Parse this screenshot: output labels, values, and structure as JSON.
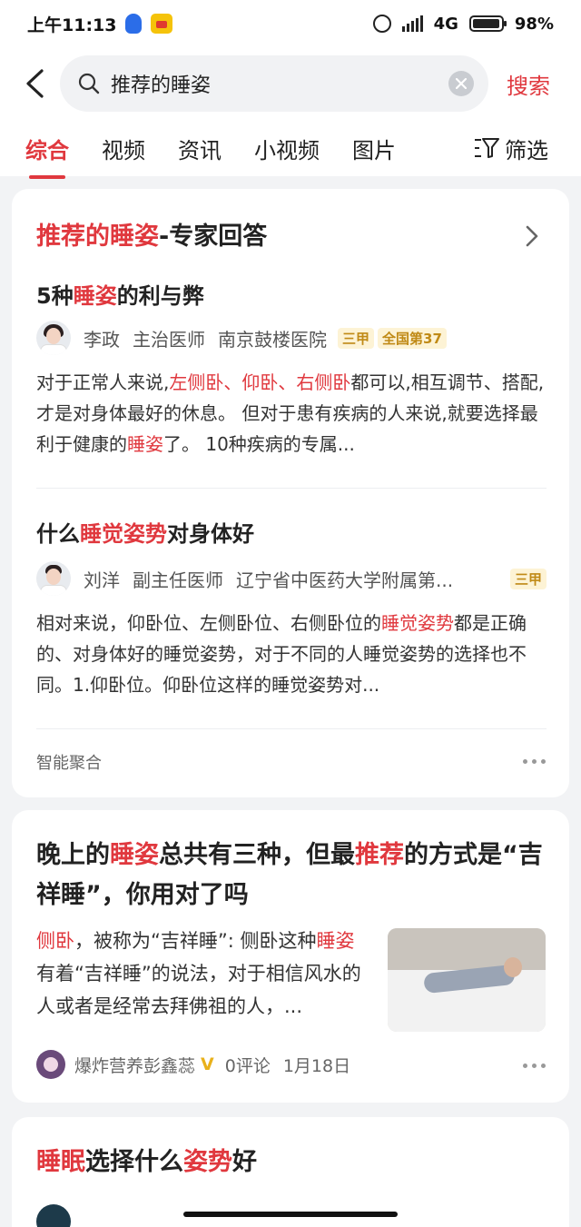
{
  "status_bar": {
    "time": "上午11:13",
    "network": "4G",
    "battery": "98%",
    "battery_level": 0.98,
    "icons": [
      "qq-icon",
      "app-badge-icon",
      "alarm-icon",
      "signal-icon",
      "battery-icon"
    ]
  },
  "search": {
    "query": "推荐的睡姿",
    "submit_label": "搜索"
  },
  "tabs": [
    {
      "label": "综合",
      "active": true
    },
    {
      "label": "视频",
      "active": false
    },
    {
      "label": "资讯",
      "active": false
    },
    {
      "label": "小视频",
      "active": false
    },
    {
      "label": "图片",
      "active": false
    }
  ],
  "filter_label": "筛选",
  "expert_card": {
    "head_highlight": "推荐的睡姿",
    "head_rest": "-专家回答",
    "answers": [
      {
        "title_pre": "5种",
        "title_hl": "睡姿",
        "title_post": "的利与弊",
        "doctor": "李政",
        "rank": "主治医师",
        "hospital": "南京鼓楼医院",
        "tags": [
          "三甲",
          "全国第37"
        ],
        "snippet_1": "对于正常人来说,",
        "snippet_hl1": "左侧卧、仰卧、右侧卧",
        "snippet_2": "都可以,相互调节、搭配,才是对身体最好的休息。 但对于患有疾病的人来说,就要选择最利于健康的",
        "snippet_hl2": "睡姿",
        "snippet_3": "了。 10种疾病的专属..."
      },
      {
        "title_pre": "什么",
        "title_hl": "睡觉姿势",
        "title_post": "对身体好",
        "doctor": "刘洋",
        "rank": "副主任医师",
        "hospital": "辽宁省中医药大学附属第...",
        "tags": [
          "三甲"
        ],
        "snippet_1": "相对来说，仰卧位、左侧卧位、右侧卧位的",
        "snippet_hl1": "睡觉姿势",
        "snippet_2": "都是正确的、对身体好的睡觉姿势，对于不同的人睡觉姿势的选择也不同。1.仰卧位。仰卧位这样的睡觉姿势对..."
      }
    ],
    "footer": "智能聚合"
  },
  "article_card": {
    "title_1": "晚上的",
    "title_hl1": "睡姿",
    "title_2": "总共有三种，但最",
    "title_hl2": "推荐",
    "title_3": "的方式是“吉祥睡”，你用对了吗",
    "snippet_hl1": "侧卧",
    "snippet_1": "，被称为“吉祥睡”: 侧卧这种",
    "snippet_hl2": "睡姿",
    "snippet_2": "有着“吉祥睡”的说法，对于相信风水的人或者是经常去拜佛祖的人，...",
    "author": "爆炸营养彭鑫蕊",
    "verified": "V",
    "comments": "0评论",
    "date": "1月18日"
  },
  "third_card": {
    "title_hl1": "睡眠",
    "title_1": "选择什么",
    "title_hl2": "姿势",
    "title_2": "好"
  },
  "colors": {
    "accent": "#e0383e",
    "tag_bg": "#fdf3d5",
    "tag_text": "#c08a16",
    "page_bg": "#f2f3f5"
  }
}
